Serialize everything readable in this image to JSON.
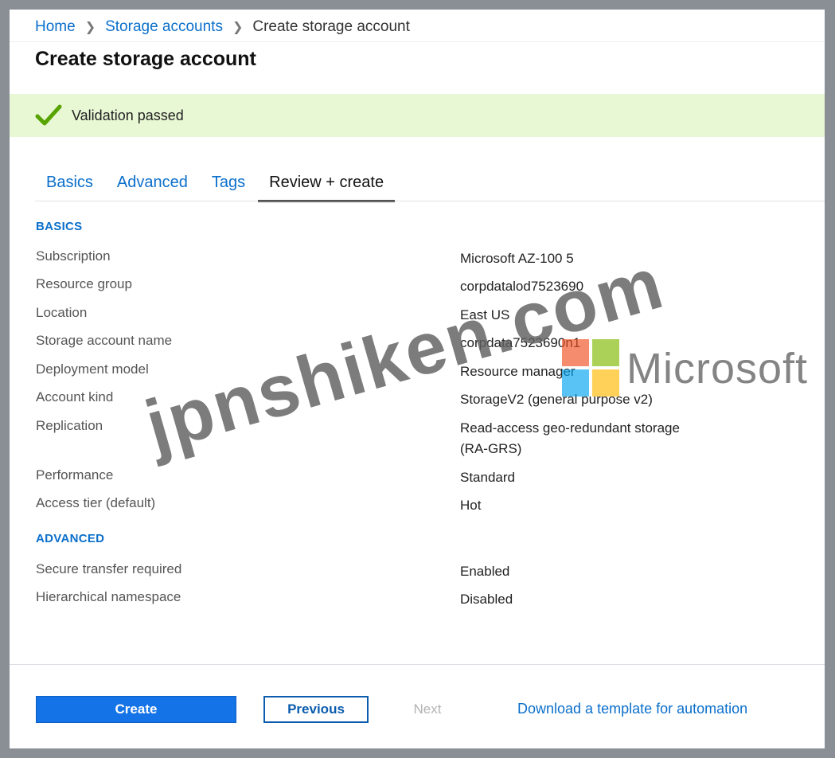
{
  "breadcrumb": [
    "Home",
    "Storage accounts",
    "Create storage account"
  ],
  "page_title": "Create storage account",
  "banner": {
    "message": "Validation passed"
  },
  "tabs": [
    {
      "label": "Basics"
    },
    {
      "label": "Advanced"
    },
    {
      "label": "Tags"
    },
    {
      "label": "Review + create",
      "active": true
    }
  ],
  "sections": {
    "basics": {
      "heading": "BASICS",
      "rows": [
        {
          "label": "Subscription",
          "value": "Microsoft AZ-100 5"
        },
        {
          "label": "Resource group",
          "value": "corpdatalod7523690"
        },
        {
          "label": "Location",
          "value": "East US"
        },
        {
          "label": "Storage account name",
          "value": "corpdata7523690n1"
        },
        {
          "label": "Deployment model",
          "value": "Resource manager"
        },
        {
          "label": "Account kind",
          "value": "StorageV2 (general purpose v2)"
        },
        {
          "label": "Replication",
          "value": "Read-access geo-redundant storage (RA-GRS)"
        },
        {
          "label": "Performance",
          "value": "Standard"
        },
        {
          "label": "Access tier (default)",
          "value": "Hot"
        }
      ]
    },
    "advanced": {
      "heading": "ADVANCED",
      "rows": [
        {
          "label": "Secure transfer required",
          "value": "Enabled"
        },
        {
          "label": "Hierarchical namespace",
          "value": "Disabled"
        }
      ]
    }
  },
  "footer": {
    "create_label": "Create",
    "previous_label": "Previous",
    "next_label": "Next",
    "template_link": "Download a template for automation"
  },
  "watermark": {
    "site": "jpnshiken.com",
    "brand": "Microsoft"
  },
  "colors": {
    "accent": "#0b6fcb",
    "primary_button": "#1473e6",
    "success_banner": "#e8f7d4",
    "success_check": "#57a300"
  }
}
